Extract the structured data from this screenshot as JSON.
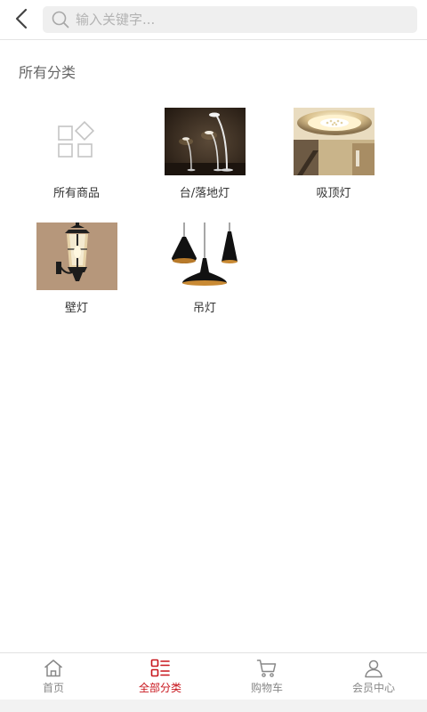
{
  "header": {
    "search_placeholder": "输入关键字..."
  },
  "section_title": "所有分类",
  "categories": [
    {
      "label": "所有商品",
      "icon": "grid-shapes-icon"
    },
    {
      "label": "台/落地灯",
      "icon": "floor-lamp-photo"
    },
    {
      "label": "吸顶灯",
      "icon": "ceiling-lamp-photo"
    },
    {
      "label": "壁灯",
      "icon": "wall-lamp-photo"
    },
    {
      "label": "吊灯",
      "icon": "pendant-lamp-photo"
    }
  ],
  "bottom_nav": {
    "items": [
      {
        "label": "首页",
        "icon": "home-icon",
        "active": false
      },
      {
        "label": "全部分类",
        "icon": "category-list-icon",
        "active": true
      },
      {
        "label": "购物车",
        "icon": "cart-icon",
        "active": false
      },
      {
        "label": "会员中心",
        "icon": "user-icon",
        "active": false
      }
    ]
  },
  "colors": {
    "accent": "#c8161d",
    "search_bg": "#efefef",
    "nav_inactive": "#888888"
  }
}
